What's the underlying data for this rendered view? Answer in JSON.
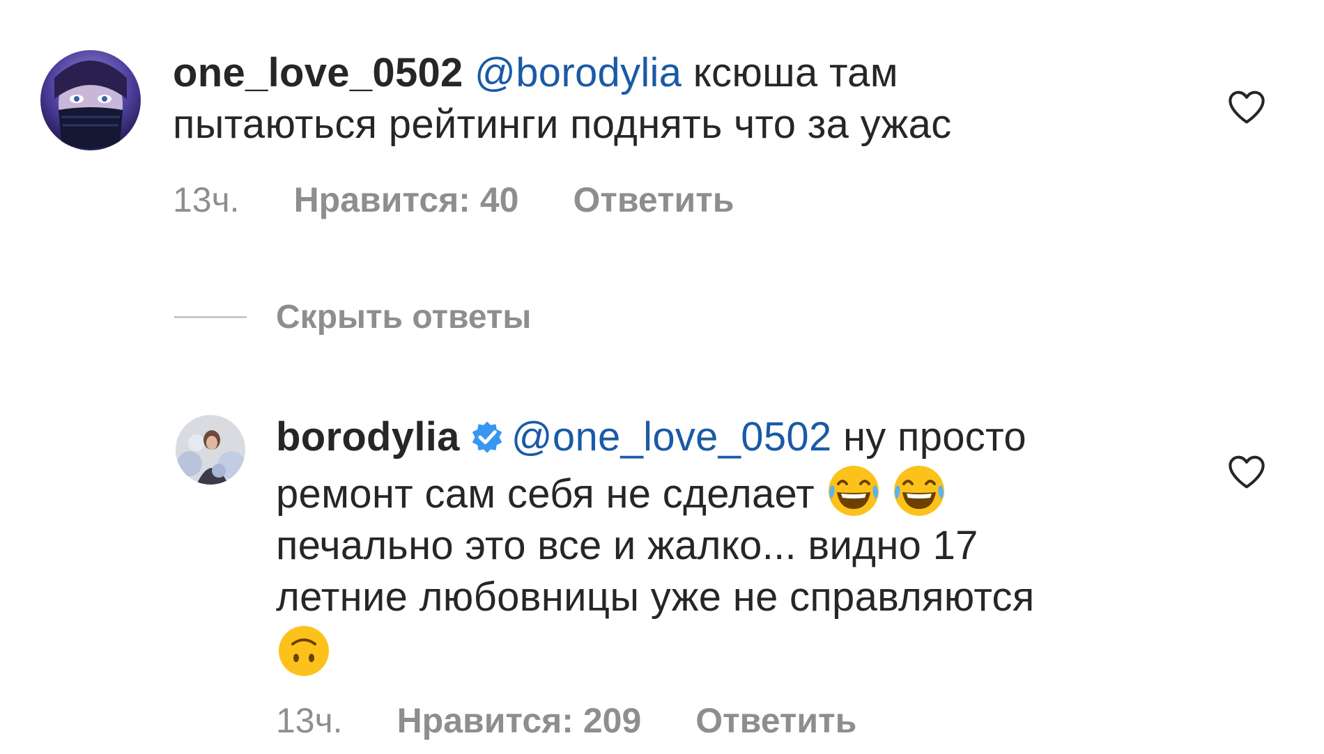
{
  "comments": [
    {
      "username": "one_love_0502",
      "mention": "@borodylia",
      "text_line1": " ксюша там",
      "text_line2": "пытаються рейтинги поднять что за ужас",
      "time": "13ч.",
      "likes": "Нравится: 40",
      "reply": "Ответить"
    },
    {
      "username": "borodylia",
      "mention": "@one_love_0502",
      "text_line1": " ну просто",
      "text_line2": "ремонт сам себя не сделает ",
      "text_line3": "печально это все и жалко... видно 17",
      "text_line4": "летние любовницы уже не справляются",
      "time": "13ч.",
      "likes": "Нравится: 209",
      "reply": "Ответить",
      "verified": true
    }
  ],
  "hide_replies_label": "Скрыть ответы",
  "icons": {
    "like": "heart-outline-icon",
    "verified": "verified-badge-icon",
    "emoji_laugh": "face-with-tears-of-joy-emoji",
    "emoji_upside": "upside-down-face-emoji"
  },
  "colors": {
    "mention": "#1a5aa6",
    "meta": "#8e8e8e",
    "verified": "#3897f0"
  }
}
